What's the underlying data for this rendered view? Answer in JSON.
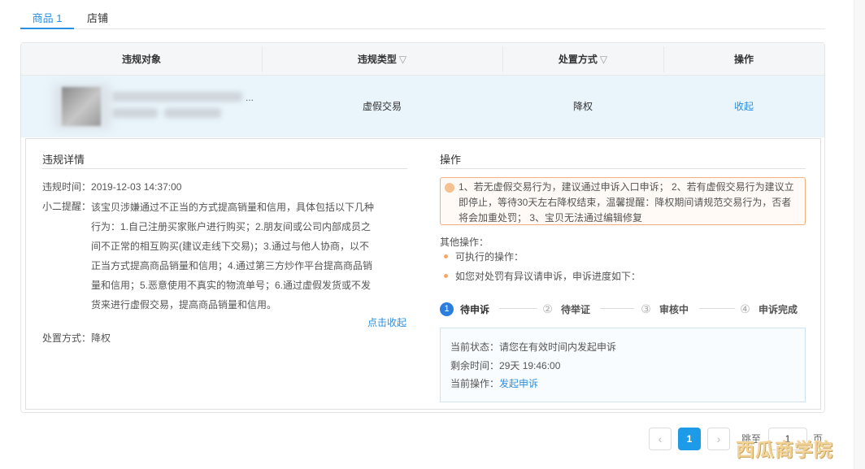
{
  "tabs": [
    {
      "label": "商品 1",
      "active": true
    },
    {
      "label": "店铺",
      "active": false
    }
  ],
  "table": {
    "headers": [
      {
        "label": "违规对象",
        "filter": false
      },
      {
        "label": "违规类型",
        "filter": true
      },
      {
        "label": "处置方式",
        "filter": true
      },
      {
        "label": "操作",
        "filter": false
      }
    ],
    "row": {
      "object_ellipsis": "...",
      "type": "虚假交易",
      "action": "降权",
      "operation": "收起"
    }
  },
  "detail": {
    "left": {
      "title": "违规详情",
      "time_label": "违规时间：",
      "time_value": "2019-12-03 14:37:00",
      "reminder_label": "小二提醒：",
      "reminder_lines": [
        "该宝贝涉嫌通过不正当的方式提高销量和信用，具体包括以下几种",
        "行为：1.自己注册买家账户进行购买；2.朋友间或公司内部成员之",
        "间不正常的相互购买(建议走线下交易)；3.通过与他人协商，以不",
        "正当方式提高商品销量和信用；4.通过第三方炒作平台提高商品销",
        "量和信用；5.恶意使用不真实的物流单号；6.通过虚假发货或不发",
        "货来进行虚假交易，提高商品销量和信用。"
      ],
      "collapse_link": "点击收起",
      "method_label": "处置方式：",
      "method_value": "降权"
    },
    "right": {
      "title": "操作",
      "warning_lines": [
        "1、若无虚假交易行为，建议通过申诉入口申诉； 2、若有虚假交易行为建议立",
        "即停止，等待30天左右降权结束，温馨提醒：降权期间请规范交易行为，否者",
        "将会加重处罚； 3、宝贝无法通过编辑修复"
      ],
      "other_ops_label": "其他操作：",
      "bullets": [
        "可执行的操作：",
        "如您对处罚有异议请申诉，申诉进度如下："
      ],
      "steps": [
        {
          "num": "1",
          "label": "待申诉",
          "active": true
        },
        {
          "num": "②",
          "label": "待举证",
          "active": false
        },
        {
          "num": "③",
          "label": "审核中",
          "active": false
        },
        {
          "num": "④",
          "label": "申诉完成",
          "active": false
        }
      ],
      "status": {
        "state_label": "当前状态：",
        "state_value": "请您在有效时间内发起申诉",
        "remain_label": "剩余时间：",
        "remain_value": "29天 19:46:00",
        "op_label": "当前操作：",
        "op_link": "发起申诉"
      }
    }
  },
  "pagination": {
    "prev": "‹",
    "current": "1",
    "next": "›",
    "jump_label": "跳至",
    "jump_value": "1",
    "page_suffix": "页"
  },
  "watermark": "西瓜商学院",
  "colors": {
    "accent": "#2b8fe0",
    "row_highlight": "#e9f4fb",
    "warning_border": "#f3b07e",
    "step_active": "#2b7ee0"
  }
}
